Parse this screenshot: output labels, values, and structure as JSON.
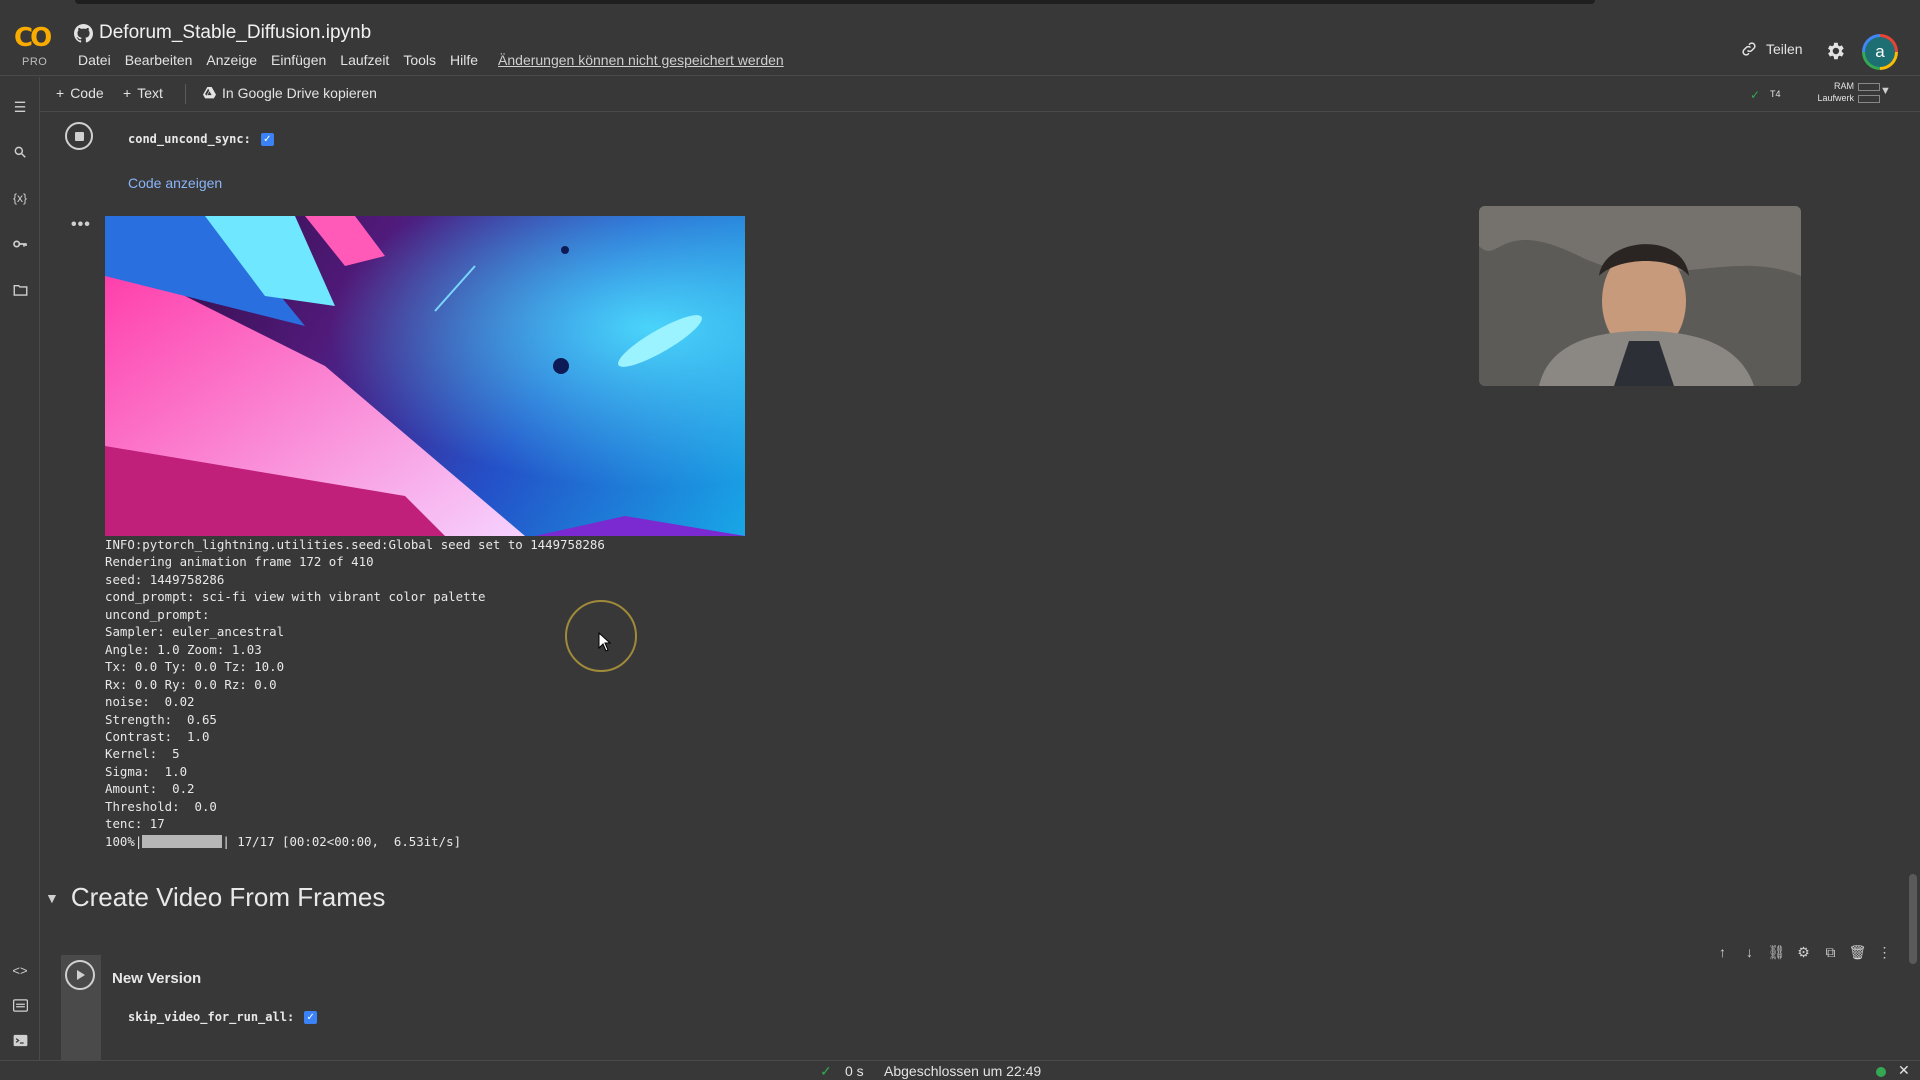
{
  "app": {
    "logo_text": "CO",
    "plan": "PRO",
    "notebook_title": "Deforum_Stable_Diffusion.ipynb"
  },
  "menu": [
    "Datei",
    "Bearbeiten",
    "Anzeige",
    "Einfügen",
    "Laufzeit",
    "Tools",
    "Hilfe"
  ],
  "unsaved_warning": "Änderungen können nicht gespeichert werden",
  "header": {
    "share_label": "Teilen",
    "avatar_letter": "a"
  },
  "toolbar": {
    "add_code": "Code",
    "add_text": "Text",
    "copy_drive": "In Google Drive kopieren"
  },
  "runtime": {
    "gpu": "T4",
    "ram_label": "RAM",
    "disk_label": "Laufwerk"
  },
  "cell1": {
    "param_name": "cond_uncond_sync:",
    "param_checked": true,
    "show_code": "Code anzeigen"
  },
  "output_log": [
    "INFO:pytorch_lightning.utilities.seed:Global seed set to 1449758286",
    "Rendering animation frame 172 of 410",
    "seed: 1449758286",
    "cond_prompt: sci-fi view with vibrant color palette",
    "uncond_prompt:",
    "Sampler: euler_ancestral",
    "Angle: 1.0 Zoom: 1.03",
    "Tx: 0.0 Ty: 0.0 Tz: 10.0",
    "Rx: 0.0 Ry: 0.0 Rz: 0.0",
    "noise:  0.02",
    "Strength:  0.65",
    "Contrast:  1.0",
    "Kernel:  5",
    "Sigma:  1.0",
    "Amount:  0.2",
    "Threshold:  0.0",
    "tenc: 17"
  ],
  "progress": {
    "percent_label": "100%",
    "fraction": 1.0,
    "tail": "| 17/17 [00:02<00:00,  6.53it/s]"
  },
  "section": {
    "title": "Create Video From Frames"
  },
  "cell2": {
    "title": "New Version",
    "param_name": "skip_video_for_run_all:",
    "param_checked": true
  },
  "statusbar": {
    "duration": "0 s",
    "completed": "Abgeschlossen um 22:49"
  }
}
